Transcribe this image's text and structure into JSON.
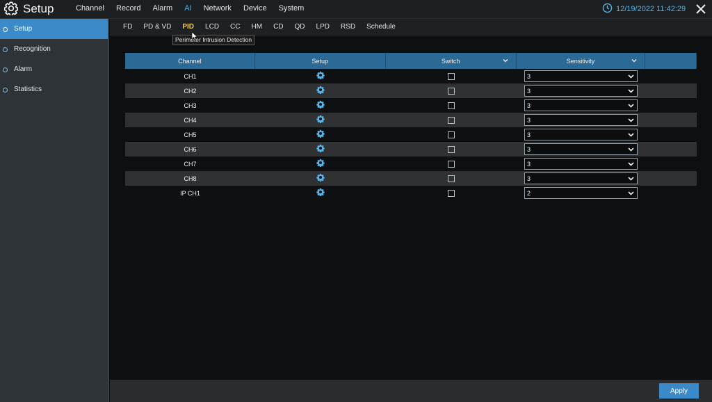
{
  "app": {
    "title": "Setup"
  },
  "main_nav": [
    {
      "label": "Channel",
      "active": false
    },
    {
      "label": "Record",
      "active": false
    },
    {
      "label": "Alarm",
      "active": false
    },
    {
      "label": "AI",
      "active": true
    },
    {
      "label": "Network",
      "active": false
    },
    {
      "label": "Device",
      "active": false
    },
    {
      "label": "System",
      "active": false
    }
  ],
  "datetime": "12/19/2022 11:42:29",
  "sidebar": {
    "items": [
      {
        "label": "Setup",
        "active": true
      },
      {
        "label": "Recognition",
        "active": false
      },
      {
        "label": "Alarm",
        "active": false
      },
      {
        "label": "Statistics",
        "active": false
      }
    ]
  },
  "sub_tabs": [
    {
      "label": "FD",
      "active": false
    },
    {
      "label": "PD & VD",
      "active": false
    },
    {
      "label": "PID",
      "active": true
    },
    {
      "label": "LCD",
      "active": false
    },
    {
      "label": "CC",
      "active": false
    },
    {
      "label": "HM",
      "active": false
    },
    {
      "label": "CD",
      "active": false
    },
    {
      "label": "QD",
      "active": false
    },
    {
      "label": "LPD",
      "active": false
    },
    {
      "label": "RSD",
      "active": false
    },
    {
      "label": "Schedule",
      "active": false
    }
  ],
  "tooltip": "Perimeter Intrusion Detection",
  "table": {
    "headers": {
      "channel": "Channel",
      "setup": "Setup",
      "switch": "Switch",
      "sensitivity": "Sensitivity"
    },
    "rows": [
      {
        "channel": "CH1",
        "switch_on": false,
        "sensitivity": "3"
      },
      {
        "channel": "CH2",
        "switch_on": false,
        "sensitivity": "3"
      },
      {
        "channel": "CH3",
        "switch_on": false,
        "sensitivity": "3"
      },
      {
        "channel": "CH4",
        "switch_on": false,
        "sensitivity": "3"
      },
      {
        "channel": "CH5",
        "switch_on": false,
        "sensitivity": "3"
      },
      {
        "channel": "CH6",
        "switch_on": false,
        "sensitivity": "3"
      },
      {
        "channel": "CH7",
        "switch_on": false,
        "sensitivity": "3"
      },
      {
        "channel": "CH8",
        "switch_on": false,
        "sensitivity": "3"
      },
      {
        "channel": "IP CH1",
        "switch_on": false,
        "sensitivity": "2"
      }
    ]
  },
  "apply_label": "Apply",
  "colors": {
    "accent": "#3c8ac8",
    "active_subtab": "#f2c84b",
    "header_bg": "#2c6a96",
    "icon_blue": "#56b4e9"
  }
}
